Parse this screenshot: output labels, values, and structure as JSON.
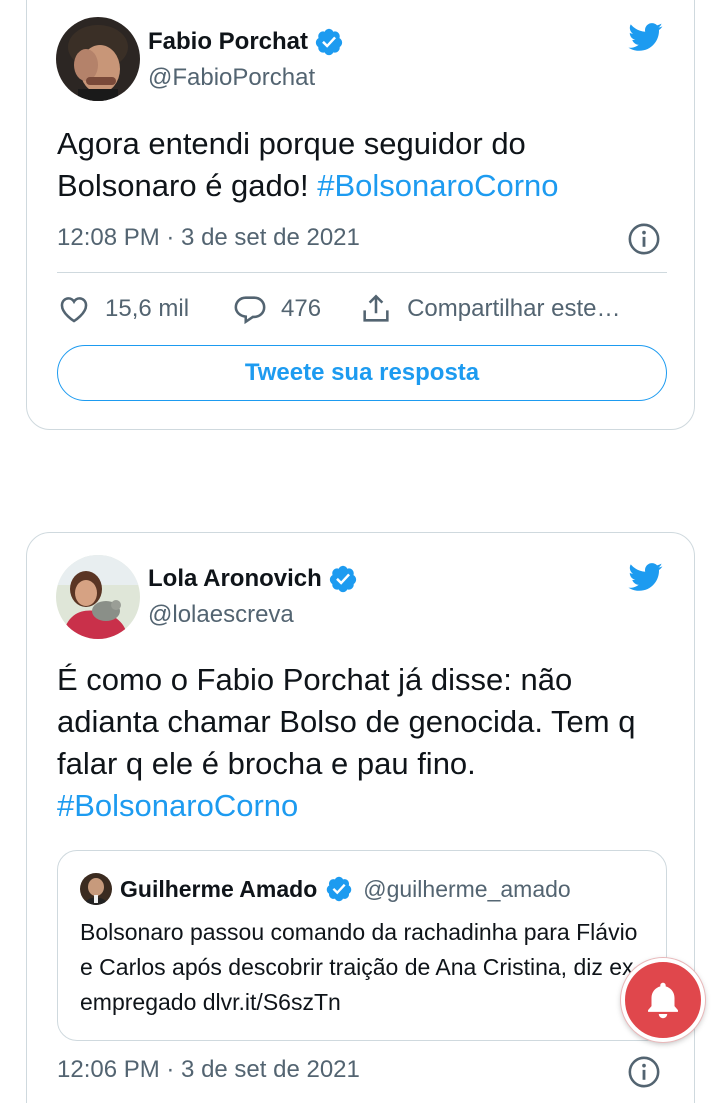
{
  "tweets": [
    {
      "author_name": "Fabio Porchat",
      "author_handle": "@FabioPorchat",
      "text_plain": "Agora entendi porque seguidor do Bolsonaro é gado! ",
      "hashtag": "#BolsonaroCorno",
      "timestamp": "12:08 PM · 3 de set de 2021",
      "likes": "15,6 mil",
      "replies": "476",
      "share_label": "Compartilhar este…",
      "reply_button": "Tweete sua resposta"
    },
    {
      "author_name": "Lola Aronovich",
      "author_handle": "@lolaescreva",
      "text_plain": "É como o Fabio Porchat já disse: não adianta chamar Bolso de genocida. Tem q falar q ele é brocha e pau fino. ",
      "hashtag": "#BolsonaroCorno",
      "quote": {
        "author_name": "Guilherme Amado",
        "author_handle": "@guilherme_amado",
        "text": "Bolsonaro passou comando da rachadinha para Flávio e Carlos após descobrir traição de Ana Cristina, diz ex-empregado dlvr.it/S6szTn"
      },
      "timestamp": "12:06 PM · 3 de set de 2021"
    }
  ],
  "icons": {
    "verified": "verified-badge-icon",
    "bird": "twitter-bird-icon",
    "info": "info-icon",
    "like": "heart-icon",
    "reply": "reply-bubble-icon",
    "share": "share-icon",
    "notification": "bell-icon"
  },
  "colors": {
    "accent": "#1d9bf0",
    "text": "#0f1419",
    "secondary": "#536471",
    "border": "#cfd9de",
    "notification_bell_bg": "#e0474c"
  }
}
